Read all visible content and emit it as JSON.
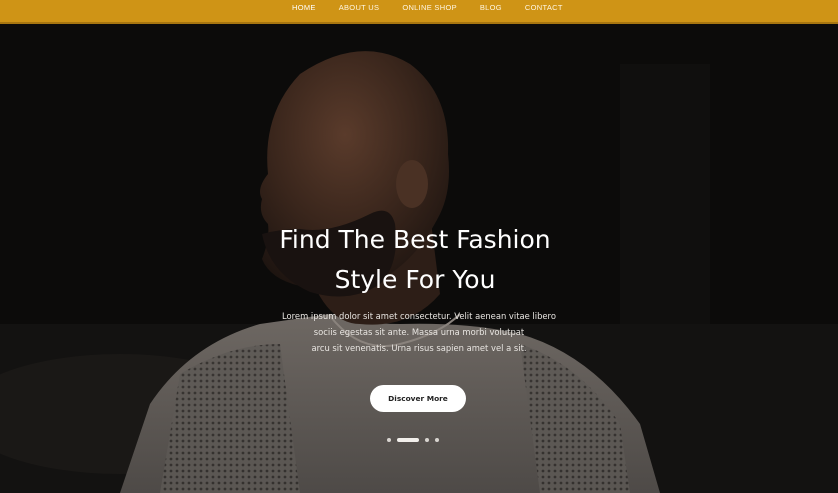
{
  "nav": {
    "items": [
      {
        "label": "HOME",
        "active": true
      },
      {
        "label": "ABOUT US",
        "active": false
      },
      {
        "label": "ONLINE SHOP",
        "active": false
      },
      {
        "label": "BLOG",
        "active": false
      },
      {
        "label": "CONTACT",
        "active": false
      }
    ]
  },
  "hero": {
    "title_line1": "Find The Best Fashion",
    "title_line2": "Style For You",
    "text_line1": "Lorem ipsum dolor sit amet consectetur. Velit aenean vitae libero",
    "text_line2": "sociis egestas sit ante. Massa urna morbi volutpat",
    "text_line3": "arcu sit venenatis. Urna risus sapien amet vel a sit.",
    "cta_label": "Discover More"
  },
  "slider": {
    "slide_count": 4,
    "active_slide": 2
  },
  "colors": {
    "navbar": "#cf9416",
    "hero_overlay": "#0b0a09",
    "button": "#ffffff"
  }
}
